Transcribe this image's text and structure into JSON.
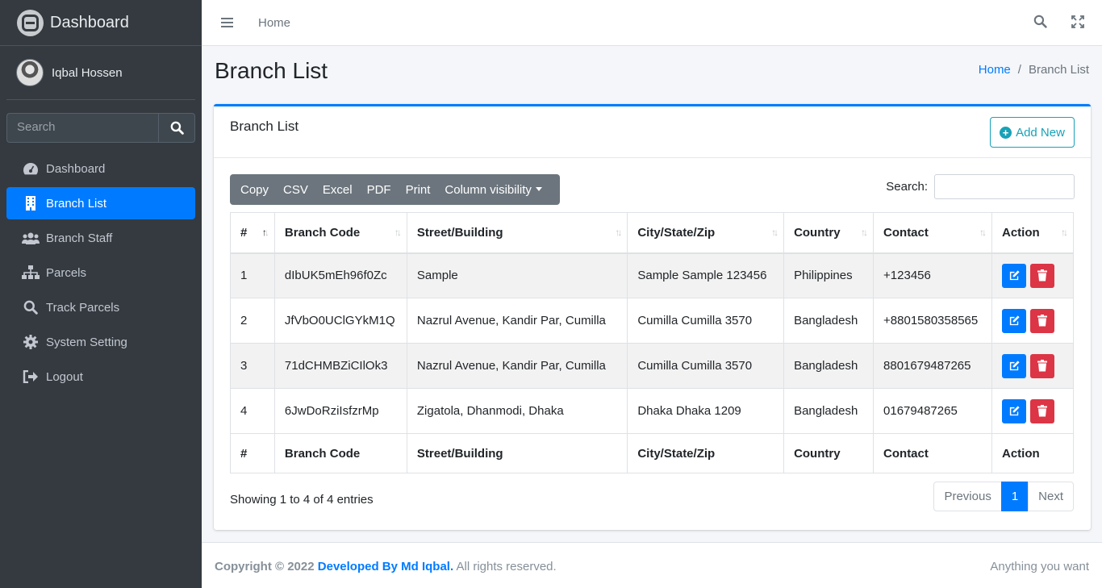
{
  "brand": {
    "title": "Dashboard"
  },
  "user": {
    "name": "Iqbal Hossen"
  },
  "sidebar": {
    "search_placeholder": "Search",
    "items": [
      {
        "label": "Dashboard",
        "icon": "tachometer-icon"
      },
      {
        "label": "Branch List",
        "icon": "building-icon",
        "active": true
      },
      {
        "label": "Branch Staff",
        "icon": "users-icon"
      },
      {
        "label": "Parcels",
        "icon": "sitemap-icon"
      },
      {
        "label": "Track Parcels",
        "icon": "search-icon"
      },
      {
        "label": "System Setting",
        "icon": "gear-icon"
      },
      {
        "label": "Logout",
        "icon": "sign-out-icon"
      }
    ]
  },
  "topbar": {
    "home_link": "Home"
  },
  "header": {
    "title": "Branch List",
    "breadcrumb": {
      "home": "Home",
      "sep": "/",
      "current": "Branch List"
    }
  },
  "card": {
    "title": "Branch List",
    "add_new_label": "Add New"
  },
  "table_tools": {
    "buttons": [
      "Copy",
      "CSV",
      "Excel",
      "PDF",
      "Print",
      "Column visibility"
    ],
    "search_label": "Search:"
  },
  "table": {
    "columns": [
      "#",
      "Branch Code",
      "Street/Building",
      "City/State/Zip",
      "Country",
      "Contact",
      "Action"
    ],
    "rows": [
      [
        "1",
        "dIbUK5mEh96f0Zc",
        "Sample",
        "Sample Sample 123456",
        "Philippines",
        "+123456"
      ],
      [
        "2",
        "JfVbO0UClGYkM1Q",
        "Nazrul Avenue, Kandir Par, Cumilla",
        "Cumilla Cumilla 3570",
        "Bangladesh",
        "+8801580358565"
      ],
      [
        "3",
        "71dCHMBZiCIlOk3",
        "Nazrul Avenue, Kandir Par, Cumilla",
        "Cumilla Cumilla 3570",
        "Bangladesh",
        "8801679487265"
      ],
      [
        "4",
        "6JwDoRziIsfzrMp",
        "Zigatola, Dhanmodi, Dhaka",
        "Dhaka Dhaka 1209",
        "Bangladesh",
        "01679487265"
      ]
    ]
  },
  "info": "Showing 1 to 4 of 4 entries",
  "pagination": {
    "previous": "Previous",
    "page": "1",
    "next": "Next"
  },
  "footer": {
    "copyright": "Copyright © 2022",
    "developer": "Developed By Md Iqbal.",
    "rights": "All rights reserved.",
    "right_text": "Anything you want"
  },
  "colors": {
    "primary": "#007bff",
    "danger": "#dc3545",
    "info": "#17a2b8",
    "sidebar": "#343a40"
  }
}
